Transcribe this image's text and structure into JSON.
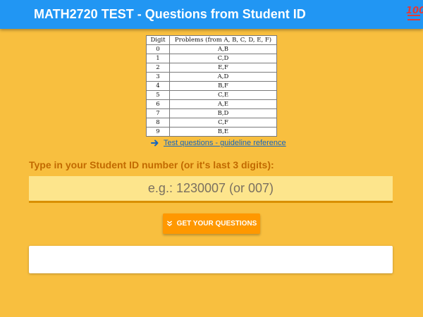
{
  "header": {
    "title": "MATH2720 TEST - Questions from Student ID",
    "icon": "hundred-points-icon",
    "icon_text": "100",
    "background": "#2196f3"
  },
  "reference_table": {
    "headers": [
      "Digit",
      "Problems (from A, B, C, D, E, F)"
    ],
    "rows": [
      [
        "0",
        "A,B"
      ],
      [
        "1",
        "C,D"
      ],
      [
        "2",
        "E,F"
      ],
      [
        "3",
        "A,D"
      ],
      [
        "4",
        "B,F"
      ],
      [
        "5",
        "C,E"
      ],
      [
        "6",
        "A,E"
      ],
      [
        "7",
        "B,D"
      ],
      [
        "8",
        "C,F"
      ],
      [
        "9",
        "B,E"
      ]
    ]
  },
  "reference_link": {
    "label": "Test questions - guideline reference",
    "icon": "arrow-right-icon"
  },
  "student_id": {
    "label": "Type in your Student ID number (or it's last 3 digits):",
    "value": "",
    "placeholder": "e.g.: 1230007 (or 007)"
  },
  "get_button": {
    "label": "GET YOUR QUESTIONS",
    "icon": "double-chevron-down-icon"
  },
  "result": {
    "text": ""
  },
  "colors": {
    "page_background": "#f8bf3f",
    "accent_orange": "#ff9800",
    "label_color": "#c26a00",
    "input_background": "#fde58c"
  }
}
